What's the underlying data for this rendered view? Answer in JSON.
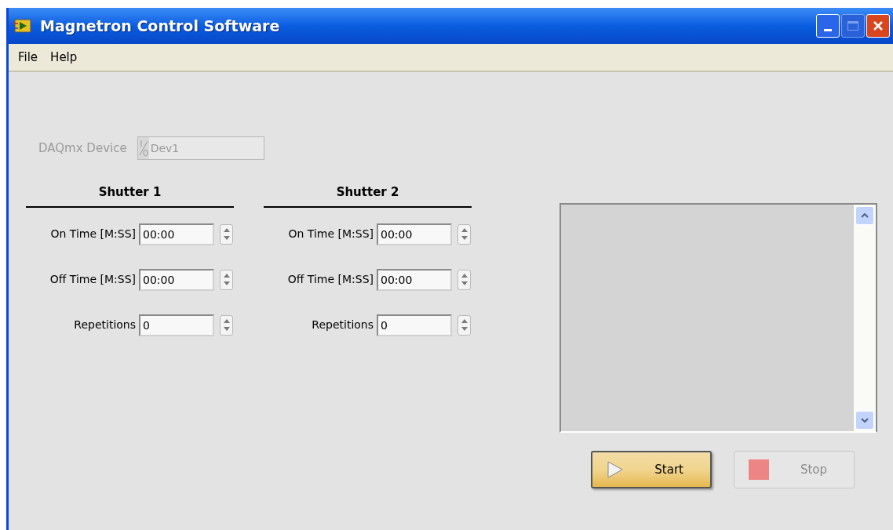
{
  "window": {
    "title": "Magnetron Control Software",
    "maximize_disabled": true
  },
  "menu": [
    {
      "label": "File"
    },
    {
      "label": "Help"
    }
  ],
  "device": {
    "label": "DAQmx Device",
    "value": "Dev1",
    "disabled": true
  },
  "shutters": [
    {
      "title": "Shutter 1",
      "fields": [
        {
          "label": "On Time [M:SS]",
          "value": "00:00"
        },
        {
          "label": "Off Time [M:SS]",
          "value": "00:00"
        },
        {
          "label": "Repetitions",
          "value": "0"
        }
      ]
    },
    {
      "title": "Shutter 2",
      "fields": [
        {
          "label": "On Time [M:SS]",
          "value": "00:00"
        },
        {
          "label": "Off Time [M:SS]",
          "value": "00:00"
        },
        {
          "label": "Repetitions",
          "value": "0"
        }
      ]
    }
  ],
  "buttons": [
    {
      "kind": "start",
      "label": "Start",
      "disabled": false
    },
    {
      "kind": "stop",
      "label": "Stop",
      "disabled": true
    }
  ]
}
